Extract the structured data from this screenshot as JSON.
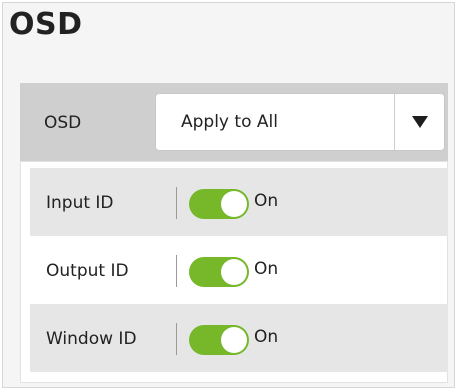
{
  "page": {
    "title": "OSD"
  },
  "osd_setting": {
    "label": "OSD",
    "selected": "Apply to All",
    "arrow_icon": "triangle-down-icon"
  },
  "rows": [
    {
      "label": "Input ID",
      "state": "On",
      "enabled": true
    },
    {
      "label": "Output ID",
      "state": "On",
      "enabled": true
    },
    {
      "label": "Window ID",
      "state": "On",
      "enabled": true
    }
  ],
  "colors": {
    "toggle_on": "#77b82a",
    "header_bg": "#cfcfcf",
    "row_shaded": "#e6e6e6"
  }
}
